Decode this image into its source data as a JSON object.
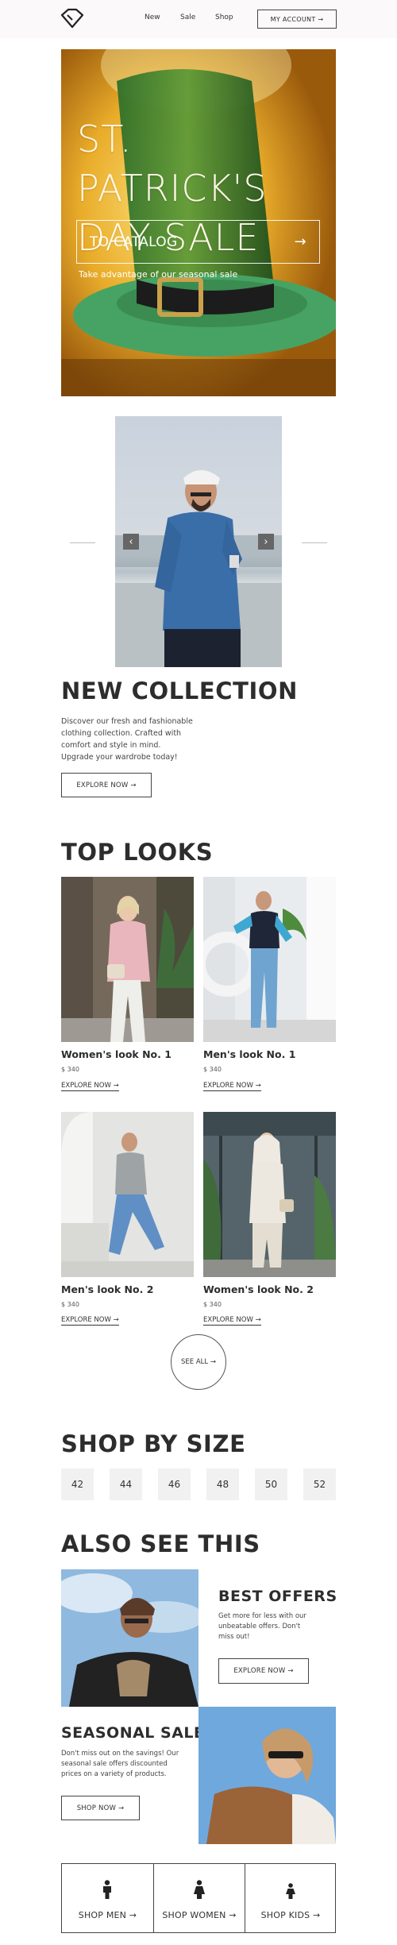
{
  "header": {
    "nav": [
      "New",
      "Sale",
      "Shop"
    ],
    "account_label": "MY ACCOUNT →"
  },
  "hero": {
    "title_line1": "ST. PATRICK'S",
    "title_line2": "DAY SALE",
    "button_label": "TO CATALOG",
    "button_arrow": "→",
    "subtitle": "Take advantage of our seasonal sale"
  },
  "carousel": {
    "prev_icon": "‹",
    "next_icon": "›"
  },
  "new_collection": {
    "title": "NEW COLLECTION",
    "body": "Discover our fresh and fashionable clothing collection. Crafted with comfort and style in mind. Upgrade your wardrobe today!",
    "button_label": "EXPLORE NOW →"
  },
  "top_looks": {
    "title": "TOP LOOKS",
    "items": [
      {
        "name": "Women's look No. 1",
        "price": "$ 340",
        "link": "EXPLORE NOW →"
      },
      {
        "name": "Men's look No. 1",
        "price": "$ 340",
        "link": "EXPLORE NOW →"
      },
      {
        "name": "Men's look No. 2",
        "price": "$ 340",
        "link": "EXPLORE NOW →"
      },
      {
        "name": "Women's look No. 2",
        "price": "$ 340",
        "link": "EXPLORE NOW →"
      }
    ],
    "see_all": "SEE ALL →"
  },
  "shop_by_size": {
    "title": "SHOP BY SIZE",
    "sizes": [
      "42",
      "44",
      "46",
      "48",
      "50",
      "52"
    ]
  },
  "also_see": {
    "title": "ALSO SEE THIS",
    "best_offers": {
      "title": "BEST OFFERS",
      "body": "Get more for less with our unbeatable offers. Don't miss out!",
      "button_label": "EXPLORE NOW →"
    },
    "seasonal_sale": {
      "title": "SEASONAL SALE",
      "body": "Don't miss out on the savings! Our seasonal sale offers discounted prices on a variety of products.",
      "button_label": "SHOP NOW →"
    }
  },
  "shop_categories": [
    {
      "label": "SHOP MEN →",
      "icon": "man-icon"
    },
    {
      "label": "SHOP WOMEN →",
      "icon": "woman-icon"
    },
    {
      "label": "SHOP KIDS →",
      "icon": "kid-icon"
    }
  ],
  "colors": {
    "header_bg": "#fbf9fa",
    "hero_gold": "#e3a624",
    "hat_green": "#3d9a5a",
    "text_dark": "#2d2d2d",
    "size_bg": "#f1f1f1"
  }
}
